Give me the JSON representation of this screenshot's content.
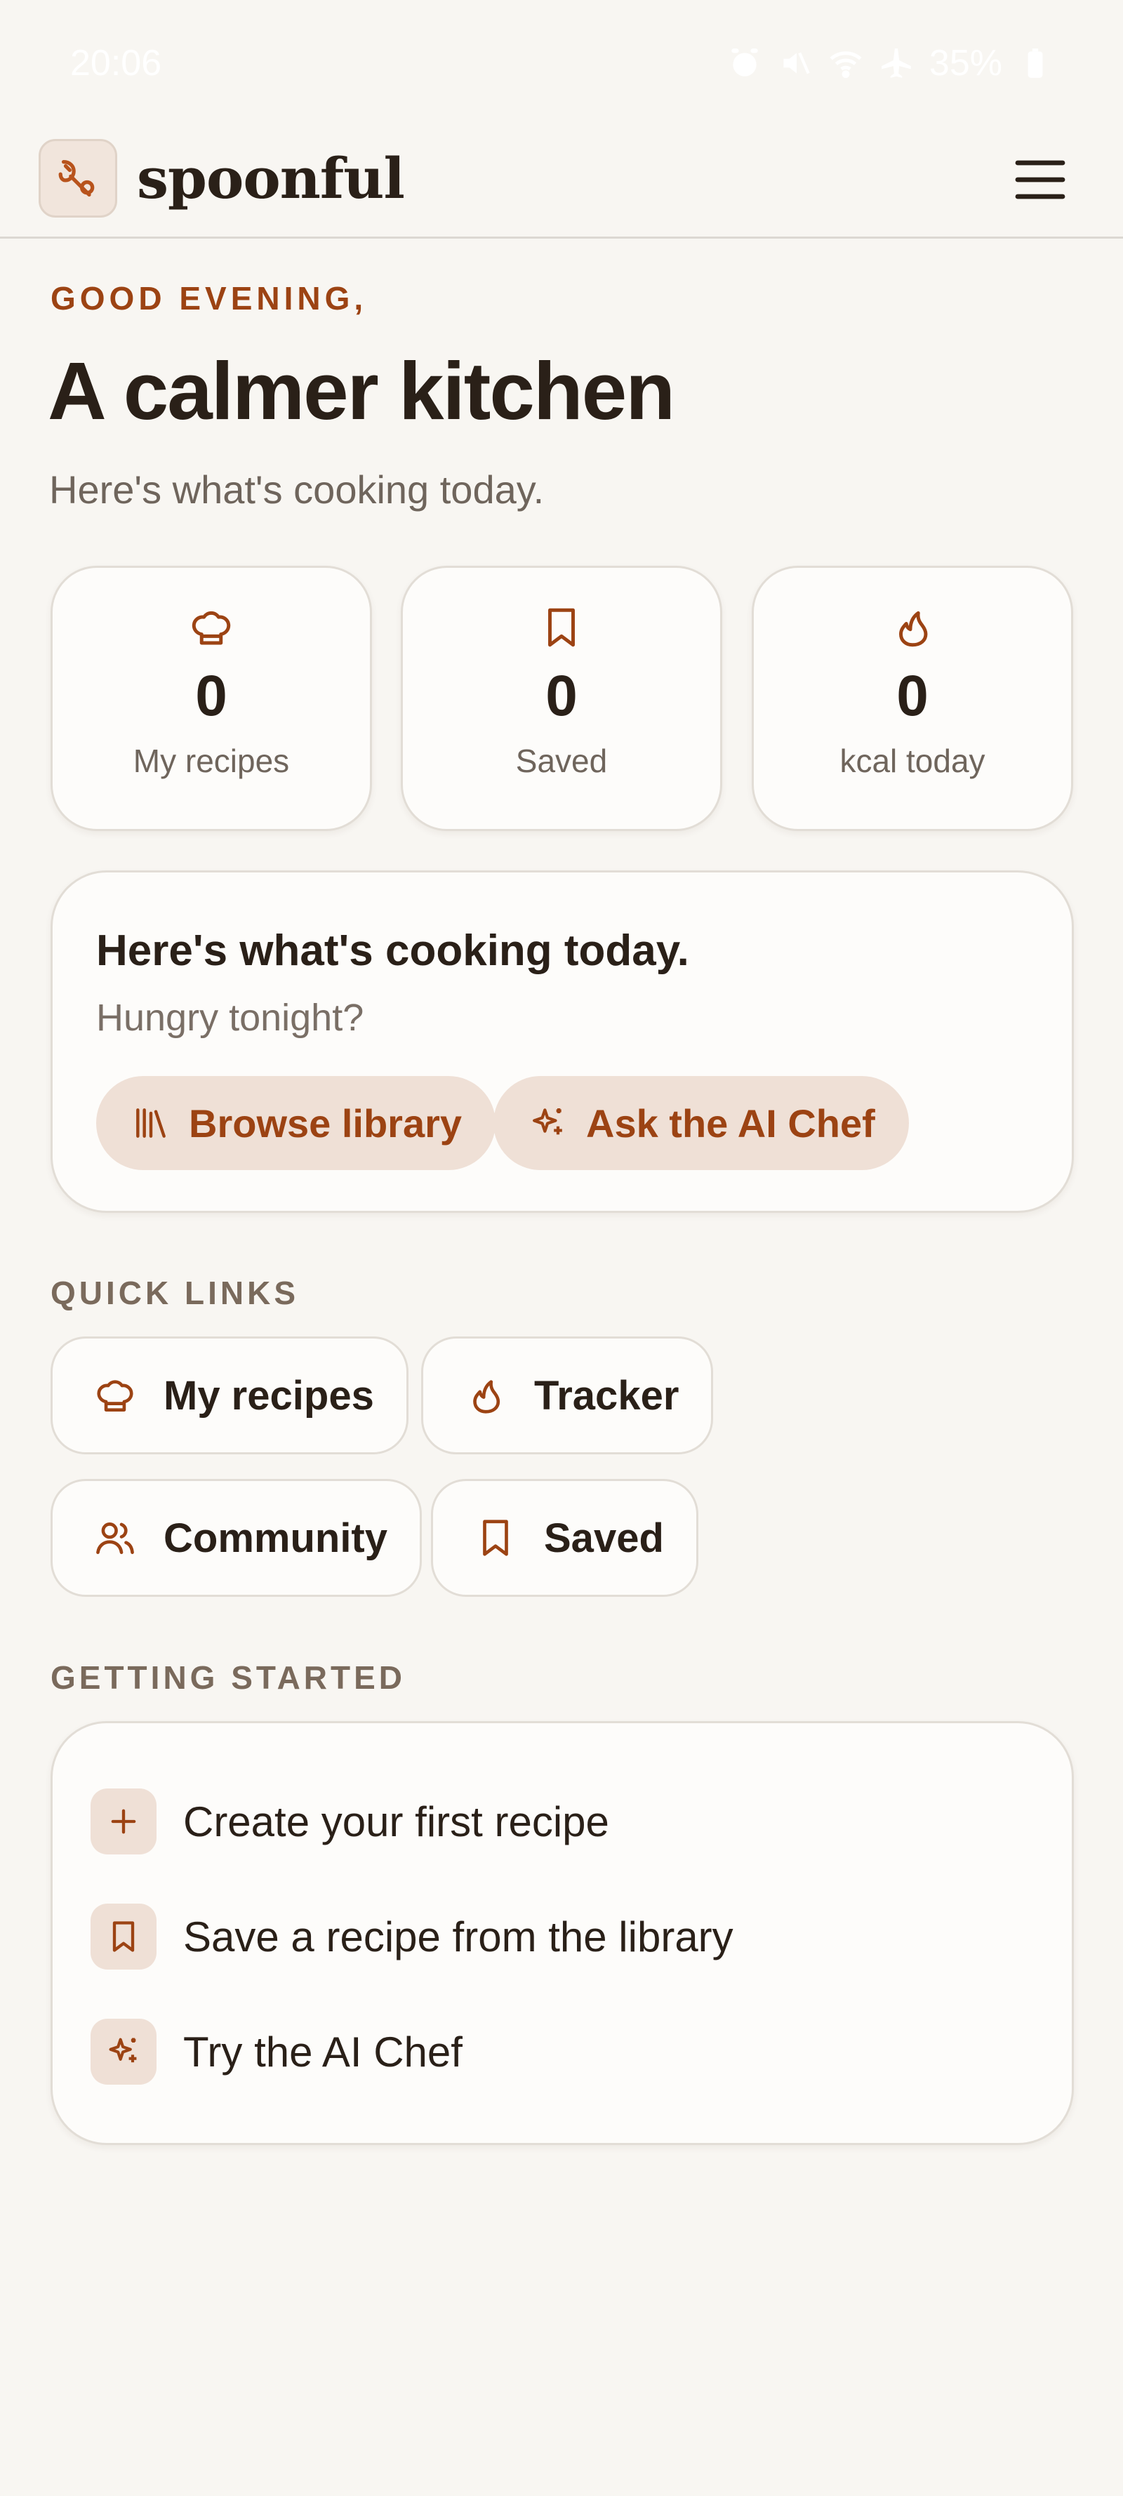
{
  "status_bar": {
    "time": "20:06",
    "battery": "35%"
  },
  "header": {
    "brand": "spoonful"
  },
  "hero": {
    "greeting": "GOOD EVENING,",
    "title": "A calmer kitchen",
    "subtitle": "Here's what's cooking today."
  },
  "stats": [
    {
      "icon": "chef-hat-icon",
      "value": "0",
      "label": "My recipes"
    },
    {
      "icon": "bookmark-icon",
      "value": "0",
      "label": "Saved"
    },
    {
      "icon": "flame-icon",
      "value": "0",
      "label": "kcal today"
    }
  ],
  "cta": {
    "title": "Here's what's cooking today.",
    "subtitle": "Hungry tonight?",
    "browse_label": "Browse library",
    "ai_label": "Ask the AI Chef"
  },
  "quick_links": {
    "label": "QUICK LINKS",
    "items": [
      {
        "icon": "chef-hat-icon",
        "label": "My recipes"
      },
      {
        "icon": "flame-icon",
        "label": "Tracker"
      },
      {
        "icon": "users-icon",
        "label": "Community"
      },
      {
        "icon": "bookmark-icon",
        "label": "Saved"
      }
    ]
  },
  "getting_started": {
    "label": "GETTING STARTED",
    "items": [
      {
        "icon": "plus-icon",
        "label": "Create your first recipe"
      },
      {
        "icon": "bookmark-icon",
        "label": "Save a recipe from the library"
      },
      {
        "icon": "sparkles-icon",
        "label": "Try the AI Chef"
      }
    ]
  },
  "colors": {
    "accent": "#9c4313",
    "background": "#f8f6f2",
    "card": "#fdfcfa",
    "pill": "#efe0d6",
    "text": "#2a2018",
    "muted": "#6f655c"
  }
}
